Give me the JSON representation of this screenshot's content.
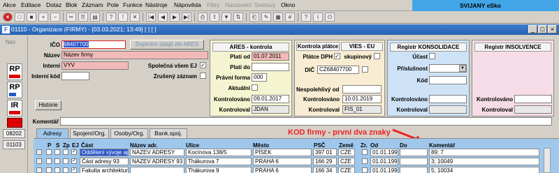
{
  "menubar": {
    "items": [
      "Akce",
      "Editace",
      "Dotaz",
      "Blok",
      "Záznam",
      "Pole",
      "Funkce",
      "Nástroje",
      "Nápověda"
    ],
    "disabled_items": [
      "Filtry",
      "Nastavení",
      "Sestavy"
    ],
    "last_item": "Okno",
    "brand": "SVIJANY eSko"
  },
  "window": {
    "title": "01110 - Organizace (FIRMY) - [03.03.2021; 13:49] [ ] [ ]",
    "icon": "F"
  },
  "nav": {
    "label": "Nav",
    "buttons": [
      "RP",
      "RP",
      "IR"
    ],
    "small_buttons": [
      "08202",
      "01103"
    ]
  },
  "form": {
    "ico_label": "IČO",
    "ico_value": "68407700",
    "doplneni_button": "Doplnění údajů dle ARES",
    "nazev_label": "Název",
    "nazev_value": "Název firmy",
    "interni_label": "Interní",
    "interni_value": "VYV",
    "spolecna_label": "Společná všem EJ",
    "interni_kod_label": "Interní kód",
    "zruseny_label": "Zrušený záznam",
    "historie_button": "Historie",
    "komentar_label": "Komentář"
  },
  "ares": {
    "title": "ARES - kontrola",
    "plati_od_label": "Platí od",
    "plati_od_value": "01.07.2011",
    "plati_do_label": "Platí do",
    "pravni_forma_label": "Právní forma",
    "pravni_forma_value": "000",
    "aktualni_label": "Aktuální",
    "kontrolovano_label": "Kontrolováno",
    "kontrolovano_value": "09.01.2017",
    "kontroloval_label": "Kontroloval",
    "kontroloval_value": "JDAN"
  },
  "kontrola_platce": {
    "title": "Kontrola plátce",
    "vies_title": "VIES - EU",
    "platce_label": "Plátce DPH",
    "skupinovy_label": "skupinový",
    "dic_label": "DIČ",
    "dic_value": "CZ68407700",
    "nespolehlivy_label": "Nespolehlivý od",
    "kontrolovano_label": "Kontrolováno",
    "kontrolovano_value": "10.01.2019",
    "kontroloval_label": "Kontroloval",
    "kontroloval_value": "FIS_01"
  },
  "konsolidace": {
    "title": "Registr KONSOLIDACE",
    "ucast_label": "Účast",
    "prislusnost_label": "Příslušnost",
    "kod_label": "Kód",
    "kontrolovano_label": "Kontrolováno",
    "kontroloval_label": "Kontroloval"
  },
  "insolvence": {
    "title": "Registr INSOLVENCE",
    "kontrolovano_label": "Kontrolováno",
    "kontroloval_label": "Kontroloval"
  },
  "tabs": [
    "Adresy",
    "Spojení/Org.",
    "Osoby/Org.",
    "Bank.spoj."
  ],
  "annotation": "KOD firmy - první dva znaky",
  "grid": {
    "headers": [
      "P",
      "S",
      "Zp",
      "EJ",
      "Část",
      "Název adr.",
      "Ulice",
      "Město",
      "PSČ",
      "Země",
      "Zr.",
      "Od",
      "Do",
      "Komentář"
    ],
    "rows": [
      {
        "cast": "Oddělení vývoje apl",
        "nazev": "NAZEV ADRESY",
        "ulice": "Kocínova 138/5",
        "mesto": "PÍSEK",
        "psc": "397 01",
        "zeme": "CZE",
        "od": "01.01.1996",
        "do": "",
        "komentar": "89; 7"
      },
      {
        "cast": "Část adresy 93",
        "nazev": "NAZEV ADRESY 93",
        "ulice": "Thákurova 7",
        "mesto": "PRAHA 6",
        "psc": "166 29",
        "zeme": "CZE",
        "od": "01.01.1996",
        "do": "",
        "komentar": "3; 10049"
      },
      {
        "cast": "Fakulta architektury",
        "nazev": "",
        "ulice": "Thákurova 9",
        "mesto": "PRAHA 6",
        "psc": "166 34",
        "zeme": "CZE",
        "od": "01.01.1996",
        "do": "",
        "komentar": "5; 10034"
      }
    ]
  }
}
